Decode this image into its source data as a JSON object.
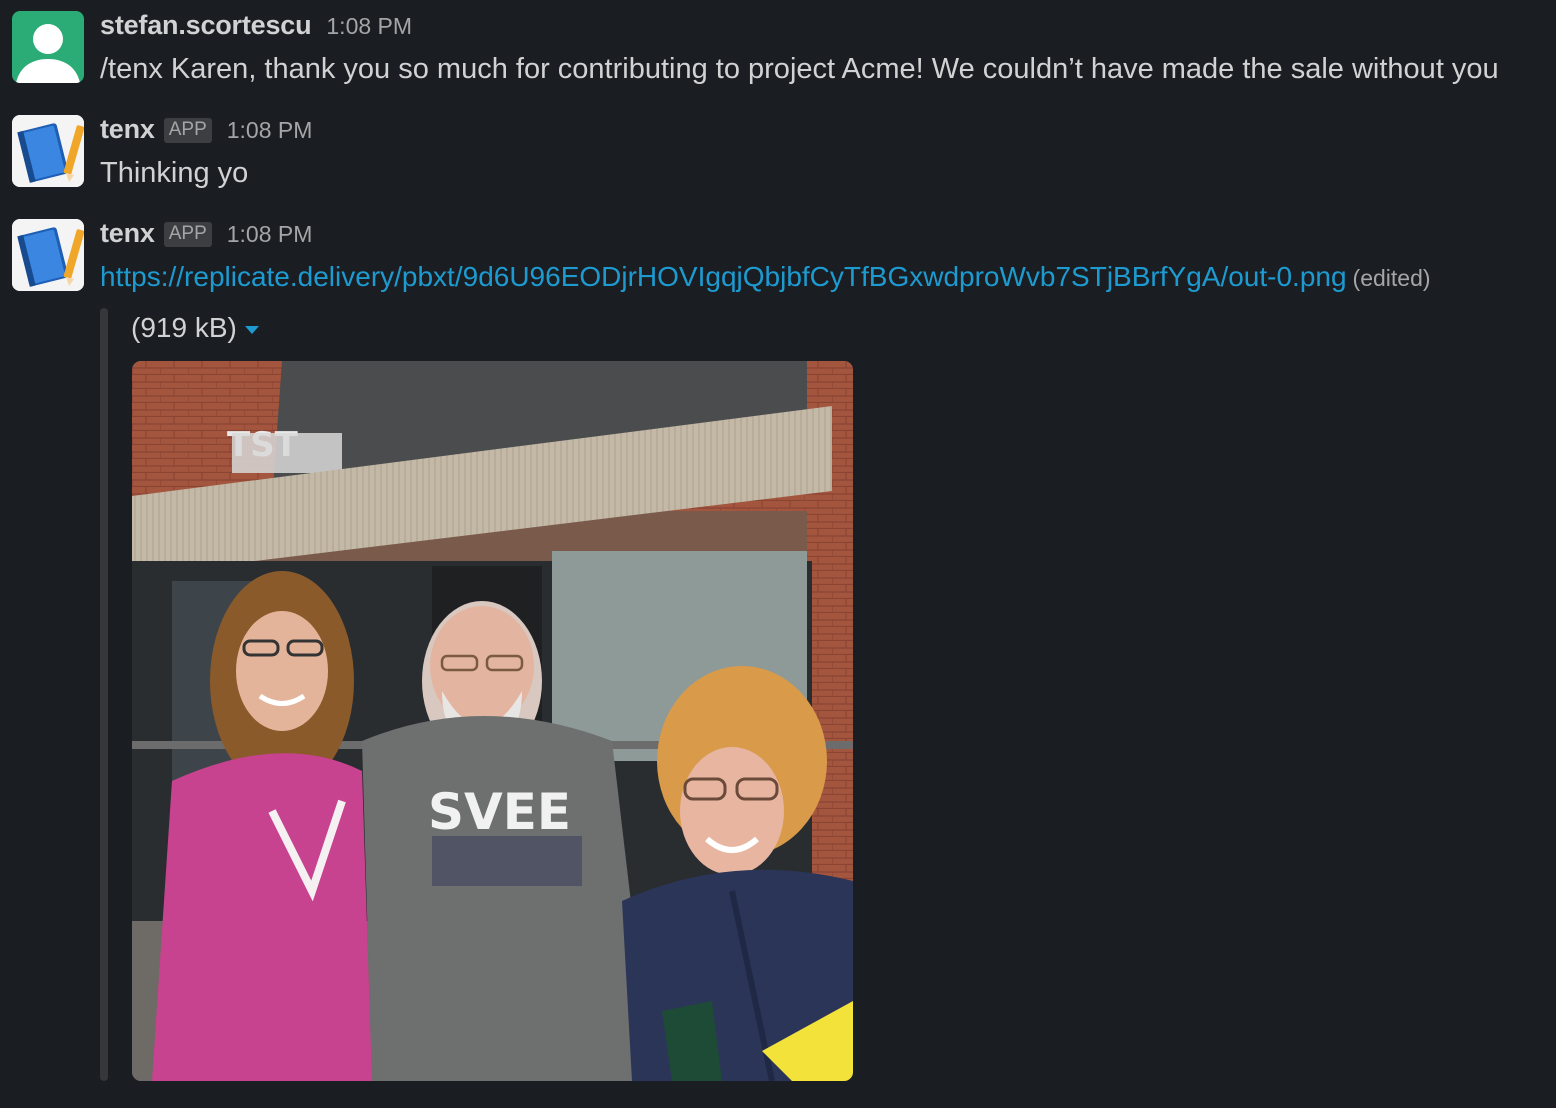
{
  "messages": [
    {
      "username": "stefan.scortescu",
      "timestamp": "1:08 PM",
      "text": "/tenx Karen, thank you so much for contributing to project Acme! We couldn’t have made the sale without you"
    },
    {
      "username": "tenx",
      "badge": "APP",
      "timestamp": "1:08 PM",
      "text": "Thinking yo"
    },
    {
      "username": "tenx",
      "badge": "APP",
      "timestamp": "1:08 PM",
      "link": "https://replicate.delivery/pbxt/9d6U96EODjrHOVIgqjQbjbfCyTfBGxwdproWvb7STjBBrfYgA/out-0.png",
      "edited_label": "(edited)",
      "attachment": {
        "size_label": "(919 kB)",
        "sign_text": "TST",
        "sweatshirt_text": "SVEE"
      }
    }
  ],
  "colors": {
    "background": "#1a1d21",
    "text": "#d1d2d3",
    "muted": "#a4a5a7",
    "link": "#1d9bd1",
    "user_avatar": "#2bac76"
  },
  "icons": {
    "user_avatar": "user-silhouette-icon",
    "app_avatar": "notebook-pencil-icon",
    "dropdown": "caret-down-icon"
  }
}
